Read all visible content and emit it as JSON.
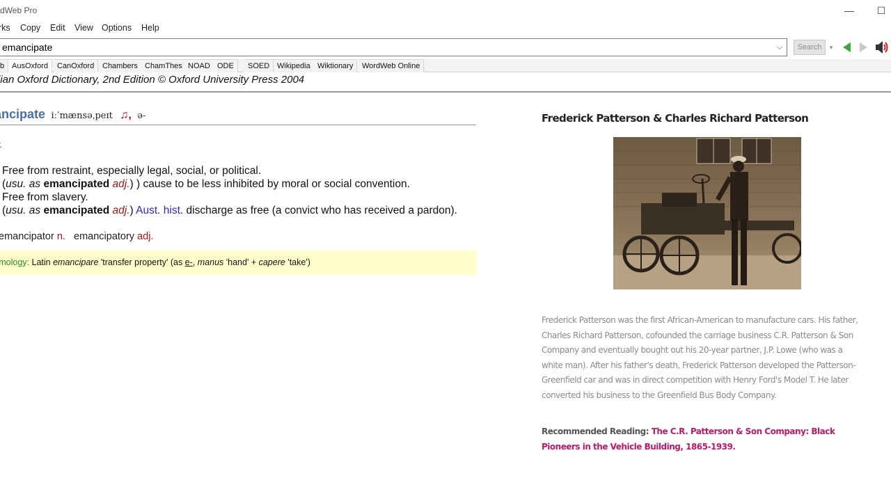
{
  "window": {
    "title": "dWeb Pro",
    "minimize": "—",
    "maximize": "☐"
  },
  "menu": [
    "rks",
    "Copy",
    "Edit",
    "View",
    "Options",
    "Help"
  ],
  "search": {
    "value": "emancipate",
    "dropdown": "⌵",
    "button_label": "Search",
    "button_dropdown": "▾"
  },
  "tabs": [
    {
      "label": "b",
      "active": false
    },
    {
      "label": "AusOxford",
      "active": true
    },
    {
      "label": "CanOxford",
      "active": false
    },
    {
      "label": "Chambers",
      "active": false
    },
    {
      "label": "ChamThes",
      "active": false
    },
    {
      "label": "NOAD",
      "active": false
    },
    {
      "label": "ODE",
      "active": false
    },
    {
      "label": "SOED",
      "active": false
    },
    {
      "label": "Wikipedia",
      "active": false
    },
    {
      "label": "Wiktionary",
      "active": false
    },
    {
      "label": "WordWeb Online",
      "active": false
    }
  ],
  "source_line": "lian Oxford Dictionary, 2nd Edition © Oxford University Press 2004",
  "entry": {
    "headword": "ancipate",
    "pronunciation": "iːˈmænsəˌpeɪt",
    "note_icon": "♫,",
    "pronunciation_alt": "ə-",
    "pos": "r.",
    "senses": [
      {
        "text": "Free from restraint, especially legal, social, or political."
      },
      {
        "pre_it": "usu.",
        "as": " as ",
        "bold": "emancipated",
        "tag": "adj.",
        "rest": ") ) cause to be less inhibited by moral or social convention."
      },
      {
        "text": "Free from slavery."
      },
      {
        "pre_it": "usu.",
        "as": " as ",
        "bold": "emancipated",
        "tag": "adj.",
        "mid": ") ",
        "region": "Aust. hist.",
        "rest": " discharge as free (a convict who has received a pardon)."
      }
    ],
    "derivatives": {
      "word1": "emancipator",
      "pos1": "n.",
      "word2": "emancipatory",
      "pos2": "adj."
    },
    "etymology": {
      "label": "ymology:",
      "lang": " Latin ",
      "word": "emancipare",
      "gloss": " 'transfer property' (as ",
      "prefix": "e-",
      "comma": ", ",
      "manus": "manus",
      "manus_gloss": " 'hand' + ",
      "capere": "capere",
      "capere_gloss": " 'take')"
    }
  },
  "panel": {
    "title": "Frederick Patterson & Charles Richard Patterson",
    "body": "Frederick Patterson was the first African-American to manufacture cars. His father, Charles Richard Patterson, cofounded the carriage business C.R. Patterson & Son Company and eventually bought out his 20-year partner, J.P. Lowe (who was a white man). After his father's death, Frederick Patterson developed the Patterson-Greenfield car and was in direct competition with Henry Ford's Model T. He later converted his business to the Greenfield Bus Body Company.",
    "reading_label": "Recommended Reading: ",
    "reading_link": "The C.R. Patterson & Son Company: Black Pioneers in the Vehicle Building, 1865-1939."
  }
}
